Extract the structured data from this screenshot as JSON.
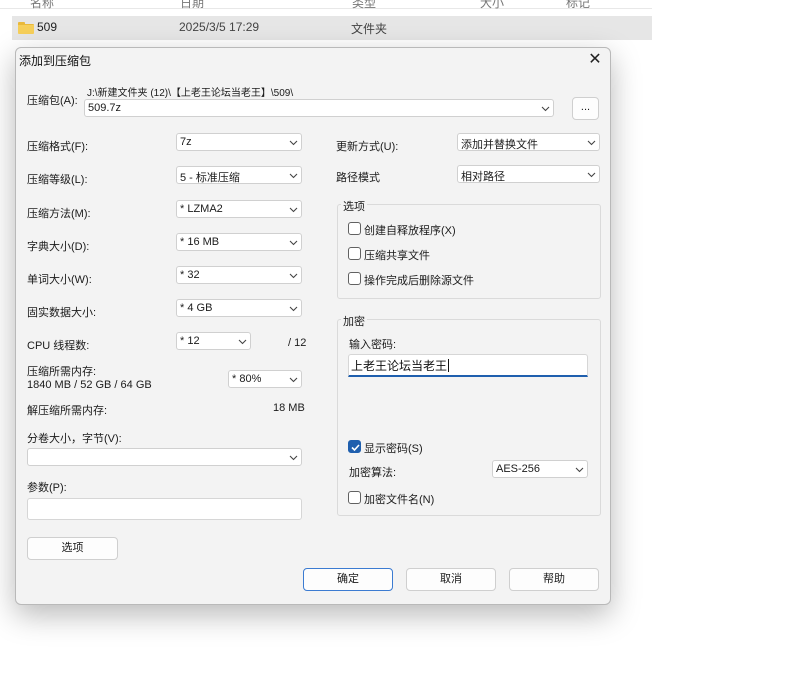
{
  "explorer": {
    "columns": [
      "名称",
      "日期",
      "类型",
      "大小",
      "标记"
    ],
    "row": {
      "name": "509",
      "date": "2025/3/5 17:29",
      "type": "文件夹"
    }
  },
  "dialog": {
    "title": "添加到压缩包",
    "archive_label": "压缩包(A):",
    "archive_path": "J:\\新建文件夹 (12)\\【上老王论坛当老王】\\509\\",
    "archive_name": "509.7z",
    "browse_label": "...",
    "left": {
      "format_label": "压缩格式(F):",
      "format_value": "7z",
      "level_label": "压缩等级(L):",
      "level_value": "5 - 标准压缩",
      "method_label": "压缩方法(M):",
      "method_value": "* LZMA2",
      "dict_label": "字典大小(D):",
      "dict_value": "* 16 MB",
      "word_label": "单词大小(W):",
      "word_value": "* 32",
      "solid_label": "固实数据大小:",
      "solid_value": "* 4 GB",
      "cpu_label": "CPU 线程数:",
      "cpu_value": "* 12",
      "cpu_total": "/ 12",
      "mem_label": "压缩所需内存:",
      "mem_info": "1840 MB / 52 GB / 64 GB",
      "mem_value": "* 80%",
      "decomp_label": "解压缩所需内存:",
      "decomp_value": "18 MB",
      "split_label": "分卷大小，字节(V):",
      "split_value": "",
      "params_label": "参数(P):",
      "params_value": "",
      "options_button": "选项"
    },
    "right": {
      "update_label": "更新方式(U):",
      "update_value": "添加并替换文件",
      "path_label": "路径模式",
      "path_value": "相对路径",
      "options_group": "选项",
      "opt_sfx": "创建自释放程序(X)",
      "opt_shared": "压缩共享文件",
      "opt_delete": "操作完成后删除源文件",
      "encrypt_group": "加密",
      "password_label": "输入密码:",
      "password_value": "上老王论坛当老王",
      "show_password": "显示密码(S)",
      "show_password_checked": true,
      "enc_method_label": "加密算法:",
      "enc_method_value": "AES-256",
      "encrypt_names": "加密文件名(N)"
    },
    "buttons": {
      "ok": "确定",
      "cancel": "取消",
      "help": "帮助"
    }
  },
  "colors": {
    "accent": "#1f5fae",
    "dialog_bg": "#f3f3f3",
    "folder": "#f6cf5a"
  }
}
